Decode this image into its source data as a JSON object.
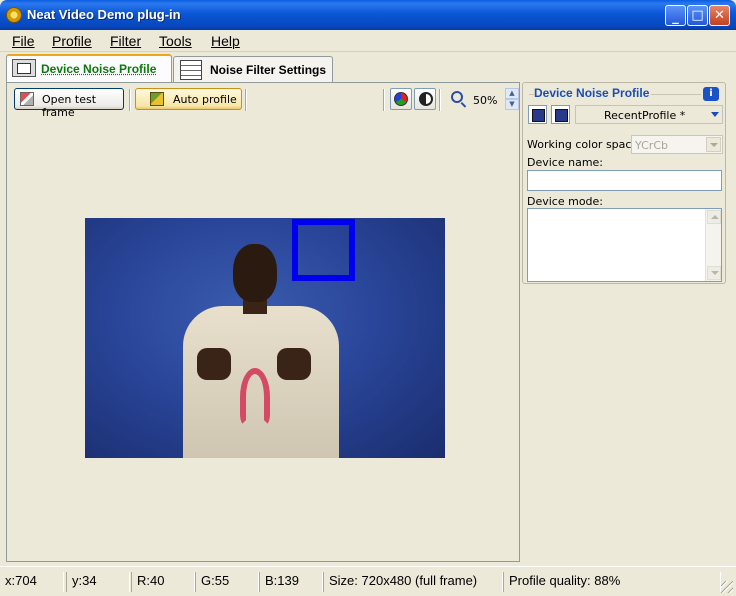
{
  "window": {
    "title": "Neat Video Demo plug-in",
    "min_glyph": "_",
    "max_glyph": "□",
    "close_glyph": "✕"
  },
  "menu": [
    "File",
    "Profile",
    "Filter",
    "Tools",
    "Help"
  ],
  "tabs": [
    {
      "label": "Device Noise Profile",
      "active": true
    },
    {
      "label": "Noise Filter Settings",
      "active": false
    }
  ],
  "toolbar": {
    "open_label": "Open test frame",
    "auto_label": "Auto profile",
    "zoom": "50%",
    "up_glyph": "▲",
    "down_glyph": "▼"
  },
  "side_panel": {
    "title": "Device Noise Profile",
    "info_glyph": "i",
    "profile_value": "RecentProfile *",
    "working_color_space_label": "Working color space:",
    "working_color_space_value": "YCrCb",
    "device_name_label": "Device name:",
    "device_name_value": "",
    "device_mode_label": "Device mode:",
    "device_mode_value": ""
  },
  "status": {
    "x": "x:704",
    "y": "y:34",
    "r": "R:40",
    "g": "G:55",
    "b": "B:139",
    "size": "Size: 720x480 (full frame)",
    "quality": "Profile quality: 88%"
  },
  "colors": {
    "selection": "#0000ee",
    "title_bar": "#0a57d6",
    "active_tab_text": "#0a7a0a",
    "panel_title": "#1b4db3"
  }
}
